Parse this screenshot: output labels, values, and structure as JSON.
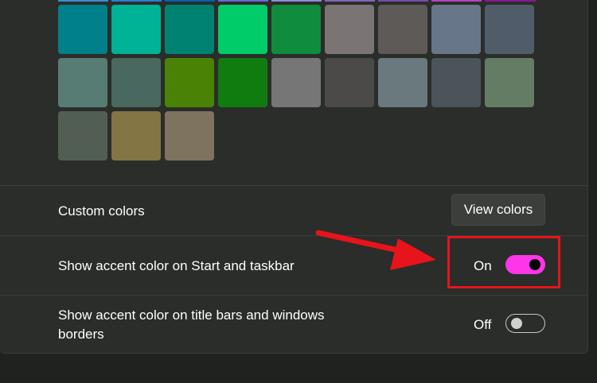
{
  "swatches": [
    "#00808a",
    "#00b296",
    "#008273",
    "#00cc6a",
    "#108c3e",
    "#7a7574",
    "#5d5a58",
    "#68768a",
    "#515c6b",
    "#567c73",
    "#486860",
    "#498205",
    "#107c10",
    "#767676",
    "#4c4a48",
    "#69797e",
    "#4a5459",
    "#647c64",
    "#525e54",
    "#847545",
    "#7e735f"
  ],
  "custom_colors": {
    "label": "Custom colors",
    "button": "View colors"
  },
  "start_taskbar": {
    "label": "Show accent color on Start and taskbar",
    "state": "On",
    "toggle_color": "#ff35ea"
  },
  "title_bars": {
    "label_line1": "Show accent color on title bars and windows",
    "label_line2": "borders",
    "state": "Off"
  },
  "annotation": {
    "color": "#e8141b"
  }
}
